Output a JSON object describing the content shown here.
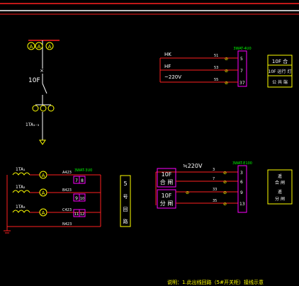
{
  "colors": {
    "background": "#000000",
    "red": "#ff2020",
    "white": "#ffffff",
    "yellow": "#ffff00",
    "magenta": "#ff00ff",
    "green": "#00ff00",
    "lime": "#c8ff00"
  },
  "header": {
    "bar_labels": []
  },
  "feeder": {
    "meter_marks": [
      "A",
      "A",
      "A"
    ],
    "breaker_label": "10F",
    "switch_mark": "×",
    "ct_label": "1TA₁₋₃"
  },
  "control_top": {
    "terminal_block_title": "3WAT-4U0",
    "wire_labels": [
      "HK",
      "HF",
      "~220V"
    ],
    "wire_numbers": [
      "51",
      "53",
      "55"
    ],
    "terminal_numbers": [
      "5",
      "7",
      "37"
    ],
    "legend": [
      "10F 合",
      "10F 运行 灯",
      "公 共 端"
    ]
  },
  "ct_circuit": {
    "ct_labels": [
      "1TA₁",
      "1TA₂",
      "1TA₃"
    ],
    "meter_marks": [
      "A",
      "A",
      "A"
    ],
    "wire_numbers": [
      "A423",
      "B423",
      "C423",
      "N423"
    ],
    "block_title": "3WAT-3U0",
    "terminal_numbers": [
      [
        "7",
        "8"
      ],
      [
        "9",
        "10"
      ],
      [
        "11",
        "12"
      ]
    ],
    "side_label": [
      "5",
      "号",
      "回",
      "路"
    ]
  },
  "control_bottom": {
    "supply_label": "≒220V",
    "box_labels": [
      [
        "10F",
        "合 闸"
      ],
      [
        "10F",
        "分 闸"
      ]
    ],
    "wire_numbers": [
      "3",
      "7",
      "33",
      "35"
    ],
    "terminal_block_title": "3WAT-E100",
    "terminal_numbers": [
      "3",
      "6",
      "9",
      "13"
    ],
    "legend": [
      "遥",
      "合 闸",
      "遥",
      "分 闸"
    ]
  },
  "footer": {
    "note": "说明：1.此出线回路（5#开关柜）接线示意"
  }
}
